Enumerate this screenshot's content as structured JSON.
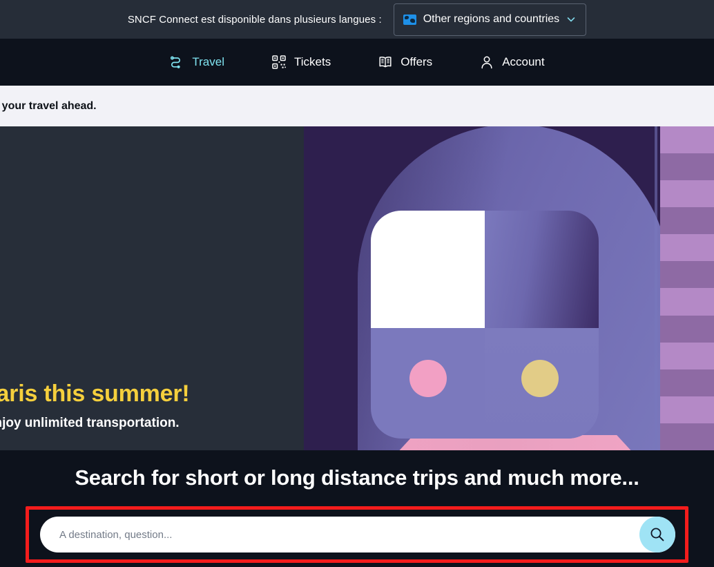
{
  "topbar": {
    "message": "SNCF Connect est disponible dans plusieurs langues :",
    "language_selector": {
      "label": "Other regions and countries",
      "icon": "globe-icon",
      "chevron": "chevron-down-icon"
    }
  },
  "nav": {
    "items": [
      {
        "label": "Travel",
        "icon": "route-icon",
        "active": true
      },
      {
        "label": "Tickets",
        "icon": "qr-code-icon",
        "active": false
      },
      {
        "label": "Offers",
        "icon": "book-icon",
        "active": false
      },
      {
        "label": "Account",
        "icon": "person-icon",
        "active": false
      }
    ]
  },
  "banner": {
    "text": "nes: plan your travel ahead."
  },
  "hero": {
    "title": "Paris this summer!",
    "subtitle": "s and enjoy unlimited transportation.",
    "illustration": "train-tunnel-illustration"
  },
  "search": {
    "heading": "Search for short or long distance trips and much more...",
    "input_value": "",
    "placeholder": "A destination, question...",
    "button_icon": "search-icon"
  },
  "colors": {
    "topbar_bg": "#262d38",
    "nav_bg": "#0d121c",
    "accent_cyan": "#7fe3f0",
    "banner_bg": "#f2f2f7",
    "hero_bg": "#272e39",
    "hero_title": "#f5cf3d",
    "illustration_bg": "#2e1f4e",
    "search_button_bg": "#9fe3f5",
    "highlight_border": "#f41c1c"
  }
}
